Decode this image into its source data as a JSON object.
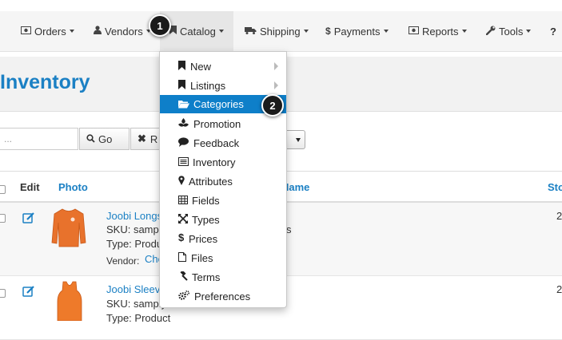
{
  "nav": {
    "orders": "Orders",
    "vendors": "Vendors",
    "catalog": "Catalog",
    "shipping": "Shipping",
    "payments": "Payments",
    "reports": "Reports",
    "tools": "Tools",
    "help": "?"
  },
  "badges": {
    "one": "1",
    "two": "2"
  },
  "page": {
    "title": "Inventory"
  },
  "filters": {
    "search_placeholder": "...",
    "go_label": "Go",
    "reset_label": "R"
  },
  "table": {
    "headers": {
      "edit": "Edit",
      "photo": "Photo",
      "name": "Name",
      "stock": "Sto"
    },
    "rows": [
      {
        "title": "Joobi Longs",
        "sku": "SKU: samph",
        "type": "Type: Product",
        "vendor_label": "Vendor:",
        "vendor": "Che",
        "desc": "s",
        "stock": "2"
      },
      {
        "title": "Joobi Sleev",
        "sku": "SKU: samply",
        "type": "Type: Product",
        "stock": "2"
      }
    ]
  },
  "menu": {
    "items": [
      {
        "label": "New",
        "icon": "bookmark-icon"
      },
      {
        "label": "Listings",
        "icon": "bookmark-icon"
      },
      {
        "label": "Categories",
        "icon": "folder-open-icon"
      },
      {
        "label": "Promotion",
        "icon": "empire-icon"
      },
      {
        "label": "Feedback",
        "icon": "comment-icon"
      },
      {
        "label": "Inventory",
        "icon": "list-alt-icon"
      },
      {
        "label": "Attributes",
        "icon": "map-marker-icon"
      },
      {
        "label": "Fields",
        "icon": "table-icon"
      },
      {
        "label": "Types",
        "icon": "arrows-icon"
      },
      {
        "label": "Prices",
        "icon": "dollar-icon"
      },
      {
        "label": "Files",
        "icon": "file-icon"
      },
      {
        "label": "Terms",
        "icon": "gavel-icon"
      },
      {
        "label": "Preferences",
        "icon": "cogs-icon"
      }
    ]
  },
  "colors": {
    "accent": "#1b80c4",
    "active_menu": "#0e7fc9"
  }
}
